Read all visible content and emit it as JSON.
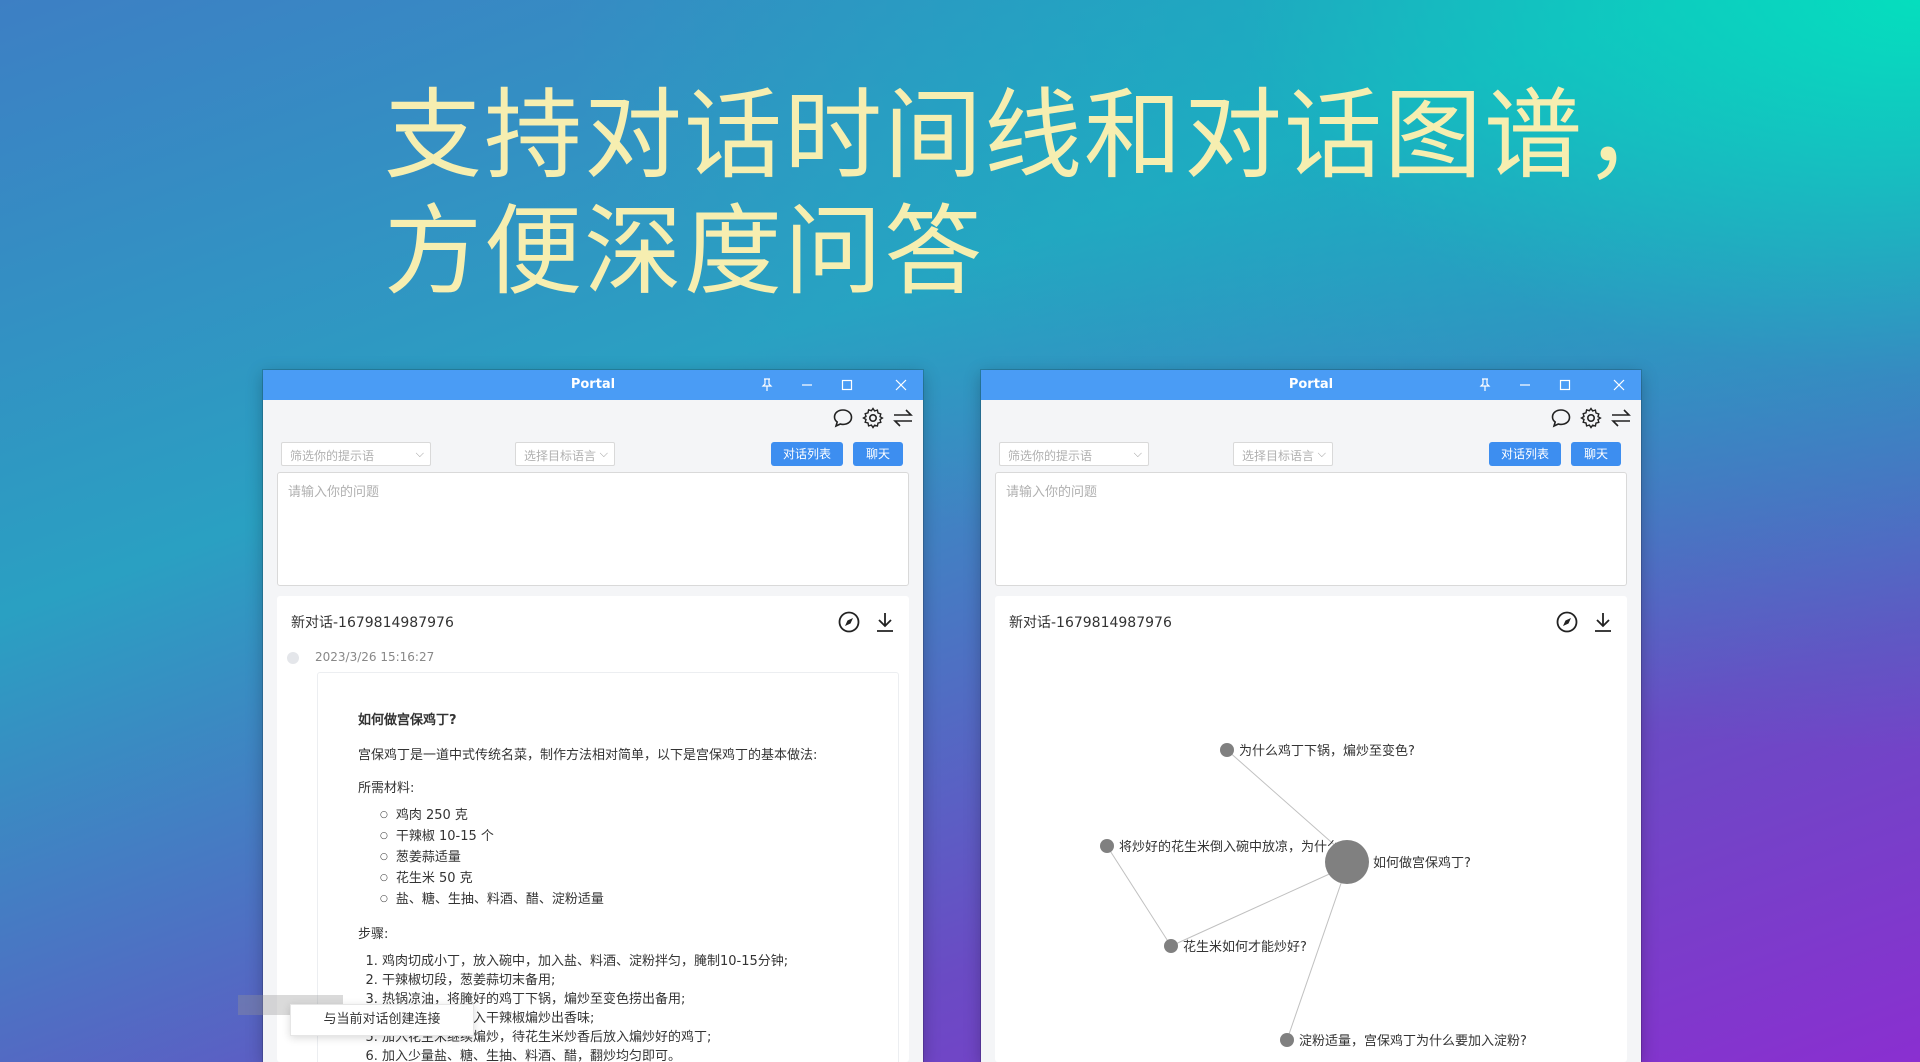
{
  "headline": {
    "line1": "支持对话时间线和对话图谱，",
    "line2": "方便深度问答"
  },
  "window_left": {
    "title": "Portal",
    "filter_prompt_placeholder": "筛选你的提示语",
    "target_placeholder": "选择目标语言",
    "conversation_list_button": "对话列表",
    "chat_button": "聊天",
    "question_placeholder": "请输入你的问题",
    "conversation_title": "新对话-1679814987976",
    "timestamp": "2023/3/26 15:16:27",
    "question": "如何做宫保鸡丁?",
    "intro": "宫保鸡丁是一道中式传统名菜，制作方法相对简单，以下是宫保鸡丁的基本做法:",
    "ingredients_heading": "所需材料:",
    "ingredients": [
      "鸡肉 250 克",
      "干辣椒 10-15 个",
      "葱姜蒜适量",
      "花生米 50 克",
      "盐、糖、生抽、料酒、醋、淀粉适量"
    ],
    "steps_heading": "步骤:",
    "steps": [
      "鸡肉切成小丁，放入碗中，加入盐、料酒、淀粉拌匀，腌制10-15分钟;",
      "干辣椒切段，葱姜蒜切末备用;",
      "热锅凉油，将腌好的鸡丁下锅，煸炒至变色捞出备用;",
      "锅中留底油，加入干辣椒煸炒出香味;",
      "加入花生米继续煸炒，待花生米炒香后放入煸炒好的鸡丁;",
      "加入少量盐、糖、生抽、料酒、醋，翻炒均匀即可。"
    ],
    "context_menu_item": "与当前对话创建连接"
  },
  "window_right": {
    "title": "Portal",
    "filter_prompt_placeholder": "筛选你的提示语",
    "target_placeholder": "选择目标语言",
    "conversation_list_button": "对话列表",
    "chat_button": "聊天",
    "question_placeholder": "请输入你的问题",
    "conversation_title": "新对话-1679814987976",
    "graph_nodes": [
      "为什么鸡丁下锅，煸炒至变色?",
      "将炒好的花生米倒入碗中放凉，为什么?",
      "如何做宫保鸡丁?",
      "花生米如何才能炒好?",
      "淀粉适量，宫保鸡丁为什么要加入淀粉?"
    ]
  },
  "colors": {
    "headline": "#f6eeb0",
    "titlebar": "#4a9cf5",
    "button": "#3d8ef0",
    "node": "#808080"
  },
  "icons": [
    "chat-bubble-icon",
    "gear-icon",
    "swap-icon",
    "pin-icon",
    "minimize-icon",
    "maximize-icon",
    "close-icon",
    "compass-icon",
    "download-icon"
  ]
}
